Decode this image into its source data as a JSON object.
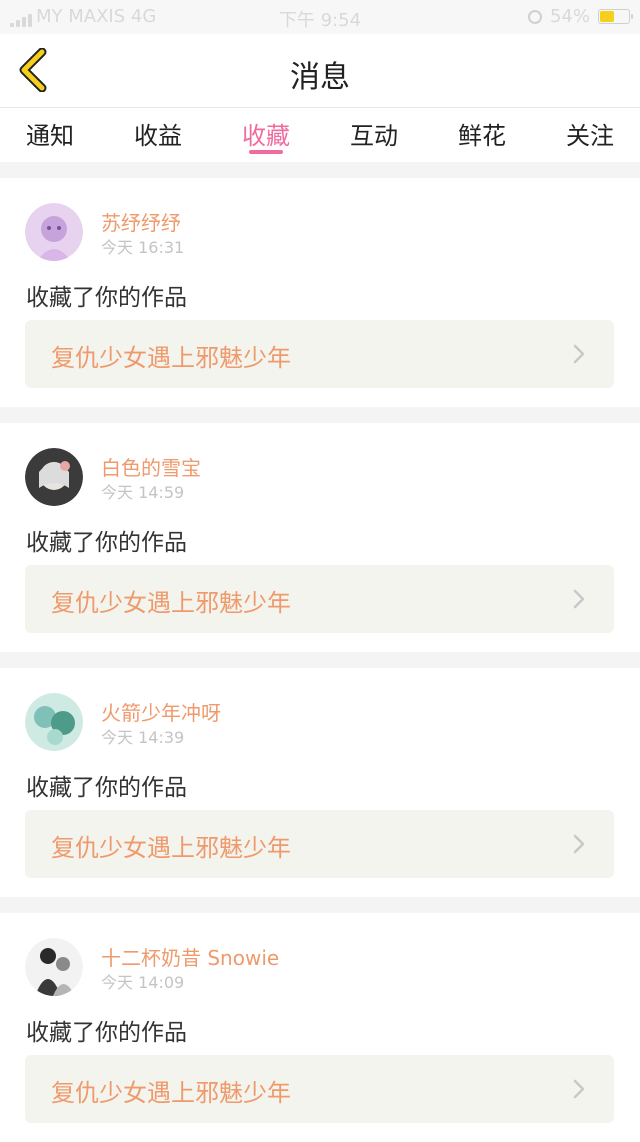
{
  "status_bar": {
    "carrier": "MY MAXIS 4G",
    "time": "下午 9:54",
    "battery": "54%",
    "battery_level": 0.54
  },
  "header": {
    "title": "消息",
    "back_icon": "chevron-left-icon"
  },
  "tabs": [
    {
      "label": "通知",
      "active": false
    },
    {
      "label": "收益",
      "active": false
    },
    {
      "label": "收藏",
      "active": true
    },
    {
      "label": "互动",
      "active": false
    },
    {
      "label": "鲜花",
      "active": false
    },
    {
      "label": "关注",
      "active": false
    }
  ],
  "messages": [
    {
      "user": "苏纾纾纾",
      "time": "今天 16:31",
      "action": "收藏了你的作品",
      "work": "复仇少女遇上邪魅少年"
    },
    {
      "user": "白色的雪宝",
      "time": "今天 14:59",
      "action": "收藏了你的作品",
      "work": "复仇少女遇上邪魅少年"
    },
    {
      "user": "火箭少年冲呀",
      "time": "今天 14:39",
      "action": "收藏了你的作品",
      "work": "复仇少女遇上邪魅少年"
    },
    {
      "user": "十二杯奶昔 Snowie",
      "time": "今天 14:09",
      "action": "收藏了你的作品",
      "work": "复仇少女遇上邪魅少年"
    }
  ],
  "colors": {
    "accent_pink": "#f06c9e",
    "username_orange": "#ef9a6c",
    "back_icon_yellow": "#f6cf1a"
  }
}
